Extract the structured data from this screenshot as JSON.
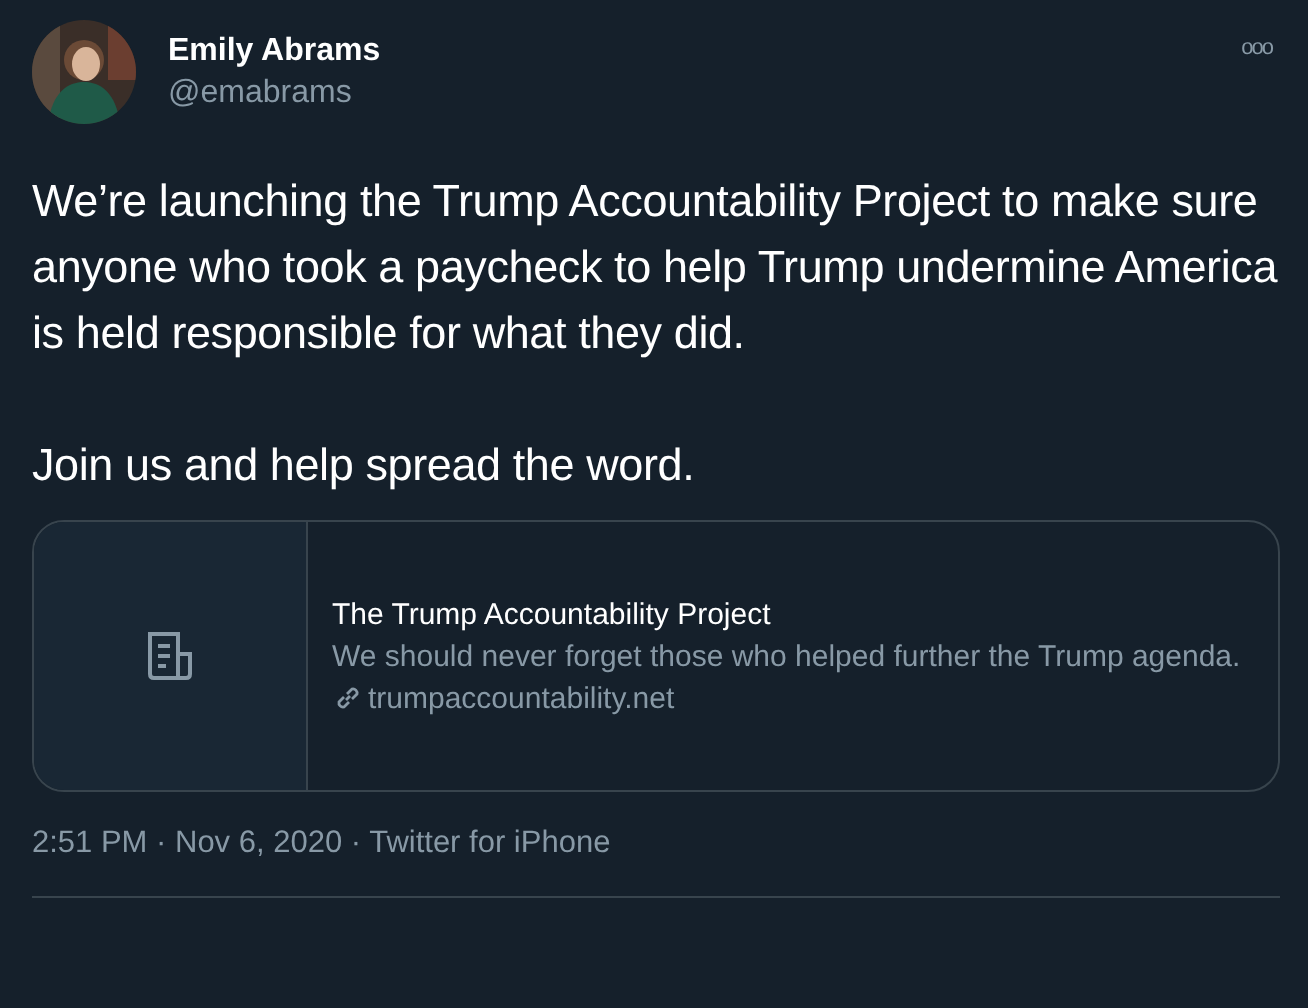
{
  "author": {
    "name": "Emily Abrams",
    "handle": "@emabrams"
  },
  "more_menu": "ooo",
  "paragraphs": [
    "We’re launching the Trump Accountability Project to make sure anyone who took a paycheck to help Trump undermine America is held responsible for what they did.",
    "Join us and help spread the word."
  ],
  "link_card": {
    "title": "The Trump Accountability Project",
    "description": "We should never forget those who helped further the Trump agenda.",
    "domain": "trumpaccountability.net"
  },
  "meta": "2:51 PM · Nov 6, 2020 · Twitter for iPhone"
}
